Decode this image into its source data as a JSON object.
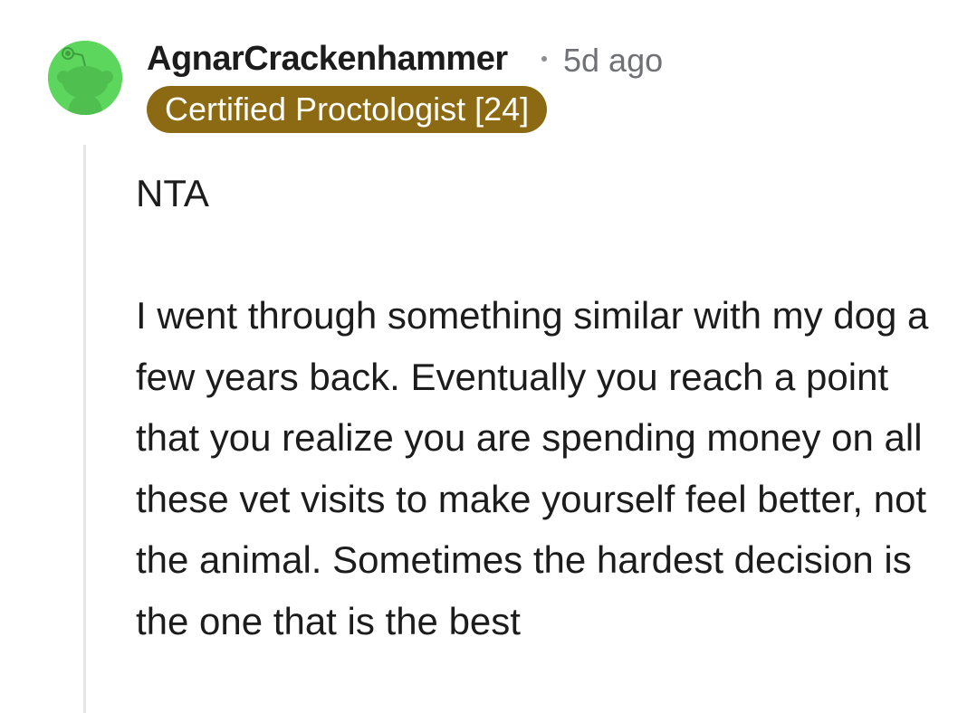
{
  "comment": {
    "author": "AgnarCrackenhammer",
    "time_ago": "5d ago",
    "flair": "Certified Proctologist [24]",
    "verdict": "NTA",
    "body": "I went through something similar with my dog a few years back. Eventually you reach a point that you realize you are spending money on all these vet visits to make yourself feel better, not the animal. Sometimes the hardest decision is the one that is the best"
  },
  "colors": {
    "avatar_bg": "#5cd65c",
    "flair_bg": "#8b6a13",
    "meta_text": "#6f7174",
    "thread_line": "#e4e5e7"
  },
  "icons": {
    "avatar": "snoo-avatar-icon",
    "separator": "dot-separator-icon"
  }
}
